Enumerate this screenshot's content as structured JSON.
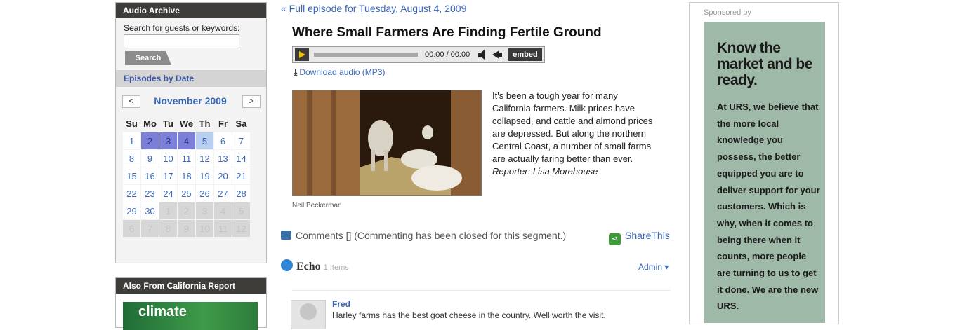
{
  "sidebar": {
    "archive_title": "Audio Archive",
    "search_label": "Search for guests or keywords:",
    "search_value": "",
    "search_button": "Search",
    "episodes_heading": "Episodes by Date",
    "calendar": {
      "prev": "<",
      "next": ">",
      "month": "November 2009",
      "weekdays": [
        "Su",
        "Mo",
        "Tu",
        "We",
        "Th",
        "Fr",
        "Sa"
      ],
      "weeks": [
        [
          "1",
          "2",
          "3",
          "4",
          "5",
          "6",
          "7"
        ],
        [
          "8",
          "9",
          "10",
          "11",
          "12",
          "13",
          "14"
        ],
        [
          "15",
          "16",
          "17",
          "18",
          "19",
          "20",
          "21"
        ],
        [
          "22",
          "23",
          "24",
          "25",
          "26",
          "27",
          "28"
        ],
        [
          "29",
          "30",
          "1",
          "2",
          "3",
          "4",
          "5"
        ],
        [
          "6",
          "7",
          "8",
          "9",
          "10",
          "11",
          "12"
        ]
      ],
      "state_colors": {
        "selected": "#7c7fd8",
        "highlight": "#b9cff0",
        "outside": "#d6d6d6"
      }
    },
    "also_title": "Also From California Report",
    "also_promo": "climate"
  },
  "main": {
    "back_link": "« Full episode for Tuesday, August 4, 2009",
    "headline": "Where Small Farmers Are Finding Fertile Ground",
    "player": {
      "time": "00:00 / 00:00",
      "embed": "embed",
      "volume_icon": "volume-icon",
      "play_icon": "play-icon"
    },
    "download": "Download audio (MP3)",
    "photo_credit": "Neil Beckerman",
    "story_text": "It's been a tough year for many California farmers. Milk prices have collapsed, and cattle and almond prices are depressed. But along the northern Central Coast, a number of small farms are actually faring better than ever.",
    "reporter_label": "Reporter:",
    "reporter_name": "Lisa Morehouse",
    "comments": "Comments [] (Commenting has been closed for this segment.)",
    "share": "ShareThis",
    "echo": {
      "title": "Echo",
      "count": "1 Items",
      "admin": "Admin",
      "comment_author": "Fred",
      "comment_text": "Harley farms has the best goat cheese in the country. Well worth the visit."
    }
  },
  "ad": {
    "sponsor_label": "Sponsored by",
    "headline": "Know the market and be ready.",
    "body": "At URS, we believe that the more local knowledge you possess, the better equipped you are to deliver support for your customers. Which is why, when it comes to being there when it counts, more people are turning to us to get it done. We are the new URS.",
    "bg_color": "#9fb9a8"
  }
}
